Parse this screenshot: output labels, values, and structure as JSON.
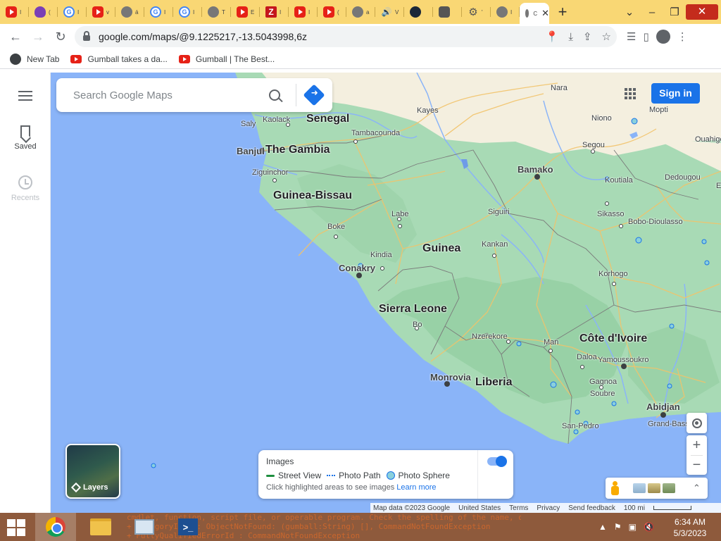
{
  "browser": {
    "tabs": [
      {
        "icon": "youtube-icon",
        "kind": "yt",
        "char": "I"
      },
      {
        "icon": "purple-leaf-icon",
        "kind": "purple",
        "char": "("
      },
      {
        "icon": "google-icon",
        "kind": "g",
        "char": "I"
      },
      {
        "icon": "youtube-icon",
        "kind": "yt",
        "char": "v"
      },
      {
        "icon": "globe-icon",
        "kind": "globe",
        "char": "á"
      },
      {
        "icon": "google-icon",
        "kind": "g",
        "char": "I"
      },
      {
        "icon": "google-icon",
        "kind": "g",
        "char": "I"
      },
      {
        "icon": "globe-icon",
        "kind": "globe",
        "char": "T"
      },
      {
        "icon": "youtube-icon",
        "kind": "yt",
        "char": "E"
      },
      {
        "icon": "zotero-icon",
        "kind": "z",
        "char": "I"
      },
      {
        "icon": "youtube-icon",
        "kind": "yt",
        "char": "I"
      },
      {
        "icon": "youtube-icon",
        "kind": "yt",
        "char": "("
      },
      {
        "icon": "globe-icon",
        "kind": "globe",
        "char": "a"
      },
      {
        "icon": "speaker-icon",
        "kind": "speaker",
        "char": "V"
      },
      {
        "icon": "steam-icon",
        "kind": "steam",
        "char": ""
      },
      {
        "icon": "shield-icon",
        "kind": "shield",
        "char": ""
      },
      {
        "icon": "gear-icon",
        "kind": "gear",
        "char": "'"
      },
      {
        "icon": "globe-icon",
        "kind": "globe",
        "char": "I"
      }
    ],
    "active_tab_char": "C",
    "url": "google.com/maps/@9.1225217,-13.5043998,6z",
    "bookmarks": [
      {
        "icon": "globe-icon",
        "label": "New Tab"
      },
      {
        "icon": "youtube-icon",
        "label": "Gumball takes a da..."
      },
      {
        "icon": "youtube-icon",
        "label": "Gumball | The Best..."
      }
    ]
  },
  "maps": {
    "search_placeholder": "Search Google Maps",
    "sign_in": "Sign in",
    "rail": {
      "saved": "Saved",
      "recents": "Recents"
    },
    "layers_label": "Layers",
    "images_panel": {
      "title": "Images",
      "street_view": "Street View",
      "photo_path": "Photo Path",
      "photo_sphere": "Photo Sphere",
      "hint": "Click highlighted areas to see images",
      "learn_more": "Learn more"
    },
    "footer": {
      "map_data": "Map data ©2023 Google",
      "country": "United States",
      "terms": "Terms",
      "privacy": "Privacy",
      "feedback": "Send feedback",
      "scale": "100 mi"
    },
    "labels": {
      "countries": [
        "Senegal",
        "The Gambia",
        "Guinea-Bissau",
        "Guinea",
        "Sierra Leone",
        "Liberia",
        "Côte d'Ivoire"
      ],
      "cities": [
        "Nara",
        "Kayes",
        "Mopti",
        "Kaolack",
        "Saly",
        "Tambacounda",
        "Niono",
        "Ouahigo",
        "Banjul",
        "Segou",
        "Ziguinchor",
        "Bamako",
        "Koutiala",
        "Dedougou",
        "Labe",
        "Siguiri",
        "Sikasso",
        "Bobo-Dioulasso",
        "Boke",
        "Kankan",
        "Kindia",
        "Conakry",
        "Korhogo",
        "Bo",
        "Nzerekore",
        "Man",
        "Daloa",
        "Yamoussoukro",
        "Monrovia",
        "Gagnoa",
        "Soubre",
        "Abidjan",
        "San-Pedro",
        "Grand-Bass",
        "E"
      ]
    }
  },
  "taskbar": {
    "time": "6:34 AM",
    "date": "5/3/2023",
    "console_lines": [
      "cmdlet, function, script file, or operable program. Check the spelling of the name, or if a path was included, verify that the path is correct and try again.",
      "    + CategoryInfo          : ObjectNotFound: (gumball:String) [], CommandNotFoundException",
      "    + FullyQualifiedErrorId : CommandNotFoundException"
    ]
  },
  "colors": {
    "ocean": "#8ab4f8",
    "land": "#a8dab5",
    "sahel": "#f5f0e1",
    "accent": "#1a73e8",
    "tabstrip": "#f9d774",
    "taskbar": "#8e5a3c"
  }
}
